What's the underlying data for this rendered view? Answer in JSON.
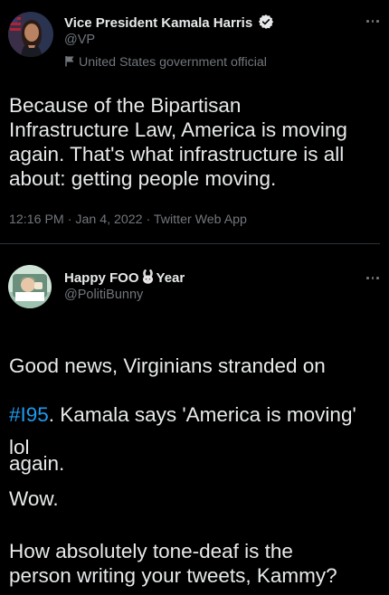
{
  "tweet1": {
    "display_name": "Vice President Kamala Harris",
    "handle": "@VP",
    "label": "United States government official",
    "text": "Because of the Bipartisan\nInfrastructure Law, America is moving\nagain. That's what infrastructure is all\nabout: getting people moving.",
    "time": "12:16 PM",
    "date": "Jan 4, 2022",
    "source": "Twitter Web App",
    "meta_separator": "·"
  },
  "tweet2": {
    "display_name_part1": "Happy FOO",
    "display_name_part2": "Year",
    "name_emoji": "rabbit-icon",
    "handle": "@PolitiBunny",
    "text_line1": "Good news, Virginians stranded on",
    "hashtag": "#I95",
    "text_line2_rest": ". Kamala says 'America is moving'",
    "text_line3": "again.",
    "text_p2": "lol",
    "text_p3": "Wow.",
    "text_p4": "How absolutely tone-deaf is the\nperson writing your tweets, Kammy?"
  },
  "colors": {
    "background": "#000000",
    "primary_text": "#e7e9ea",
    "secondary_text": "#71767b",
    "link": "#1d9bf0",
    "divider": "#2f3336"
  },
  "icons": [
    "verified-badge-icon",
    "government-flag-icon",
    "more-options-icon",
    "rabbit-icon"
  ]
}
